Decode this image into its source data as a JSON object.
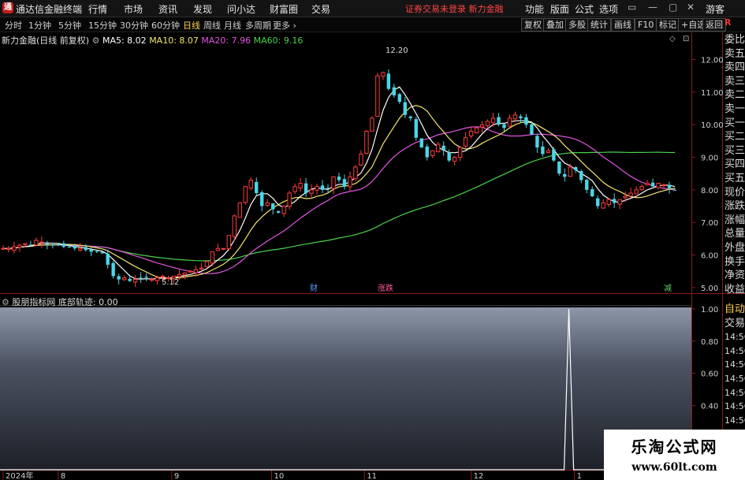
{
  "app": {
    "title": "通达信金融终端",
    "logo_char": "通"
  },
  "menu": [
    "行情",
    "市场",
    "资讯",
    "发现",
    "问小达",
    "财富圈",
    "交易"
  ],
  "warning": "证券交易未登录  新力金融",
  "top_right": [
    "功能",
    "版面",
    "公式",
    "选项",
    "游客"
  ],
  "window_buttons": [
    "▭",
    "—",
    "▢",
    "✕"
  ],
  "toolbar": {
    "timeframes": [
      "分时",
      "1分钟",
      "5分钟",
      "15分钟",
      "30分钟",
      "60分钟",
      "日线",
      "周线",
      "月线",
      "多周期",
      "更多 ›"
    ],
    "active_timeframe": "日线",
    "right_buttons": [
      "复权",
      "叠加",
      "多股",
      "统计",
      "画线",
      "F10",
      "标记",
      "+自选",
      "返回"
    ]
  },
  "main_legend": {
    "stock": "新力金融(日线 前复权)",
    "ma": [
      {
        "label": "MA5: 8.02",
        "color": "#ffffff"
      },
      {
        "label": "MA10: 8.07",
        "color": "#f5e66e"
      },
      {
        "label": "MA20: 7.96",
        "color": "#e255e2"
      },
      {
        "label": "MA60: 9.16",
        "color": "#4ad24a"
      }
    ]
  },
  "main_axis": [
    "12.00",
    "11.00",
    "10.00",
    "9.00",
    "8.00",
    "7.00",
    "6.00",
    "5.00"
  ],
  "sub_legend": {
    "name": "股朋指标网",
    "series": "底部轨迹: 0.00"
  },
  "sub_axis": [
    "1.00",
    "0.80",
    "0.60",
    "0.40"
  ],
  "date_axis": [
    "2024年",
    "8",
    "9",
    "10",
    "11",
    "12",
    "1"
  ],
  "annotations": {
    "high": "12.20",
    "low": "5.12",
    "marker_cai": "财",
    "marker_ji": "Ⓙ",
    "marker_lianban": "涨跌",
    "marker_jian": "减"
  },
  "side_panel": [
    "委比",
    "卖五",
    "卖四",
    "卖三",
    "卖二",
    "卖一",
    "买一",
    "买二",
    "买三",
    "买四",
    "买五",
    "现价",
    "涨跌",
    "涨幅",
    "总量",
    "外盘",
    "换手",
    "净资",
    "收益"
  ],
  "side_panel_lower": [
    "自动",
    "交易",
    "14:56",
    "14:56",
    "14:56",
    "14:56",
    "14:56",
    "14:56",
    "14:56",
    "14:56"
  ],
  "corner_label": "R",
  "watermark": {
    "line1": "乐淘公式网",
    "line2": "www.60lt.com"
  },
  "colors": {
    "up": "#ff3c3c",
    "down": "#4ad6e6",
    "ma60": "#4ad24a",
    "ma20": "#e255e2",
    "ma10": "#f5e66e",
    "ma5": "#ffffff"
  },
  "chart_data": {
    "type": "candlestick",
    "ylim": [
      4.9,
      12.4
    ],
    "series": [
      {
        "ma": "MA5",
        "last": 8.02
      },
      {
        "ma": "MA10",
        "last": 8.07
      },
      {
        "ma": "MA20",
        "last": 7.96
      },
      {
        "ma": "MA60",
        "last": 9.16
      }
    ],
    "approx_closes": [
      6.2,
      6.2,
      6.25,
      6.3,
      6.35,
      6.3,
      6.45,
      6.4,
      6.35,
      6.3,
      6.3,
      6.25,
      6.25,
      6.2,
      6.2,
      6.15,
      6.1,
      6.1,
      6.05,
      5.7,
      5.35,
      5.25,
      5.3,
      5.2,
      5.25,
      5.3,
      5.3,
      5.25,
      5.3,
      5.35,
      5.3,
      5.35,
      5.4,
      5.45,
      5.5,
      5.55,
      5.6,
      5.8,
      6.1,
      6.2,
      6.2,
      6.6,
      7.2,
      7.6,
      8.1,
      8.3,
      7.9,
      7.5,
      7.6,
      7.4,
      7.3,
      7.5,
      7.9,
      8.1,
      8.2,
      7.9,
      8.0,
      8.1,
      8.0,
      8.05,
      8.4,
      8.3,
      8.1,
      8.4,
      8.7,
      9.1,
      9.8,
      10.2,
      11.5,
      11.6,
      11.1,
      10.9,
      10.7,
      10.3,
      10.2,
      9.6,
      9.3,
      9.0,
      9.2,
      9.4,
      9.2,
      8.9,
      9.0,
      9.3,
      9.6,
      9.8,
      9.9,
      10.0,
      10.1,
      10.2,
      10.0,
      9.9,
      10.2,
      10.3,
      10.2,
      10.0,
      9.7,
      9.3,
      9.1,
      9.2,
      8.9,
      8.5,
      8.4,
      8.7,
      8.6,
      8.3,
      8.0,
      7.8,
      7.5,
      7.6,
      7.7,
      7.6,
      7.7,
      7.8,
      7.9,
      8.0,
      8.1,
      8.2,
      8.1,
      8.2,
      8.15,
      8.05,
      8.0
    ],
    "sub_indicator": {
      "name": "底部轨迹",
      "last": 0.0,
      "ylim": [
        0,
        1.0
      ],
      "spike_value": 1.0
    }
  }
}
